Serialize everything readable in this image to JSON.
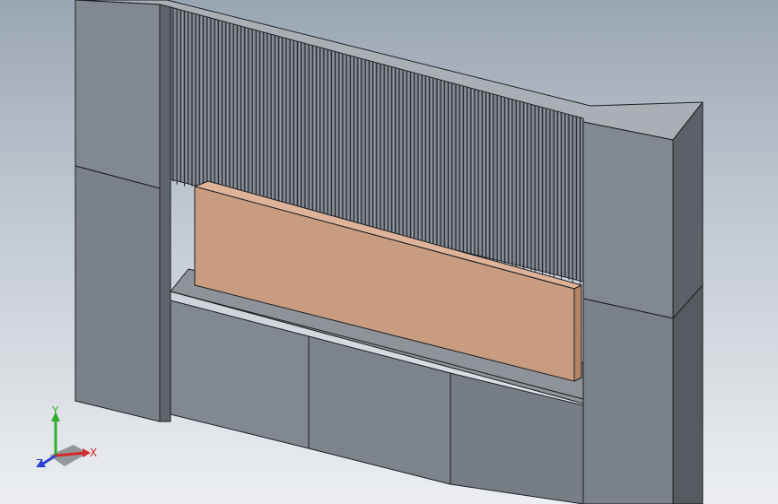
{
  "viewport": {
    "background_top": "#9aa6b3",
    "background_bottom": "#eceef1",
    "colors": {
      "wall_front": "#81888f",
      "wall_dark": "#5b6167",
      "wall_top": "#a9afb4",
      "fins": "#717880",
      "copper_front": "#c99c80",
      "copper_side": "#b48468",
      "copper_top": "#deb39a"
    }
  },
  "triad": {
    "x_label": "X",
    "y_label": "Y",
    "z_label": "Z",
    "x_color": "#d42a2a",
    "y_color": "#2fae2f",
    "z_color": "#2a3fd4"
  }
}
